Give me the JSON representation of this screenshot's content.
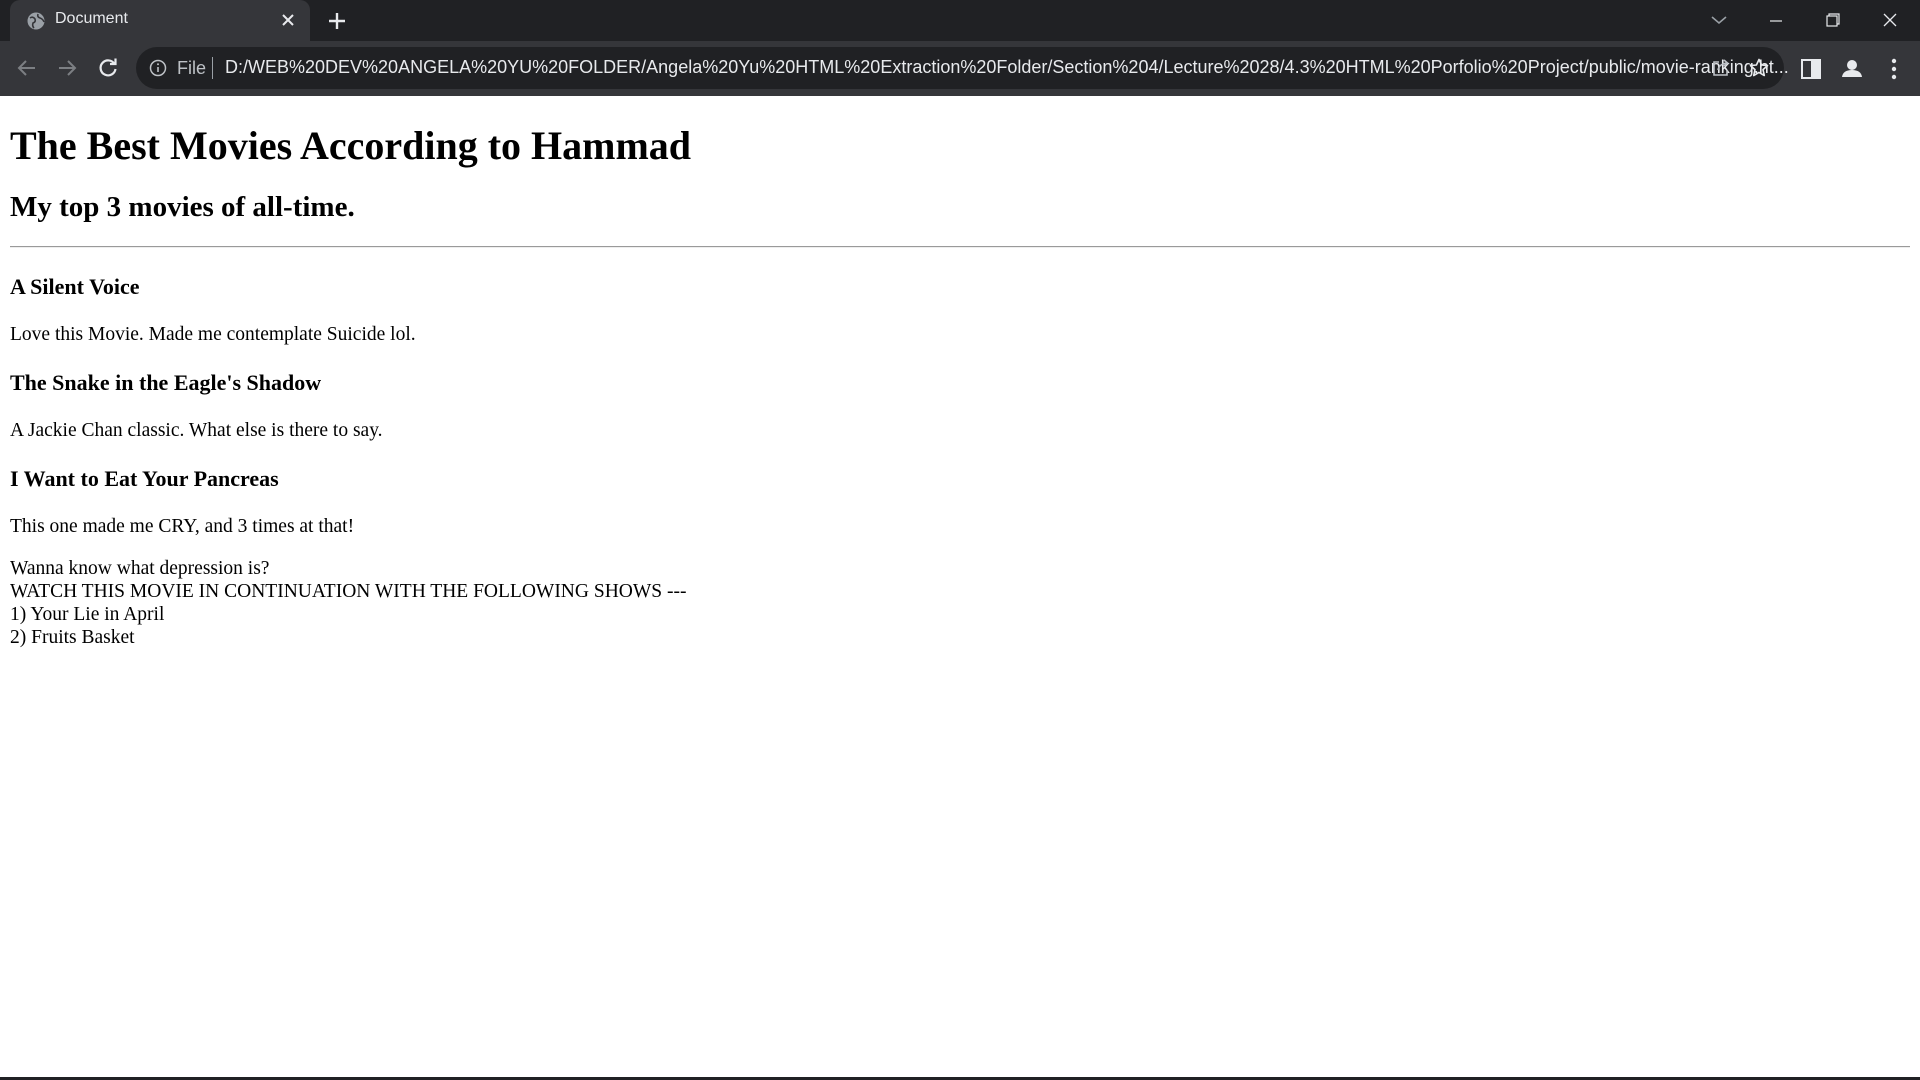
{
  "browser": {
    "tab_title": "Document",
    "scheme_label": "File",
    "url": "D:/WEB%20DEV%20ANGELA%20YU%20FOLDER/Angela%20Yu%20HTML%20Extraction%20Folder/Section%204/Lecture%2028/4.3%20HTML%20Porfolio%20Project/public/movie-ranking.ht..."
  },
  "page": {
    "title": "The Best Movies According to Hammad",
    "subtitle": "My top 3 movies of all-time.",
    "movies": [
      {
        "name": "A Silent Voice",
        "comment": "Love this Movie. Made me contemplate Suicide lol."
      },
      {
        "name": "The Snake in the Eagle's Shadow",
        "comment": "A Jackie Chan classic. What else is there to say."
      },
      {
        "name": "I Want to Eat Your Pancreas",
        "comment": "This one made me CRY, and 3 times at that!"
      }
    ],
    "notes": [
      "Wanna know what depression is?",
      "WATCH THIS MOVIE IN CONTINUATION WITH THE FOLLOWING SHOWS ---",
      "1) Your Lie in April",
      "2) Fruits Basket"
    ]
  },
  "icons": {
    "favicon": "globe-icon",
    "tab_close": "close-icon",
    "new_tab": "plus-icon",
    "tab_search": "chevron-down-icon",
    "minimize": "minimize-icon",
    "restore": "restore-icon",
    "window_close": "close-icon",
    "back": "arrow-left-icon",
    "forward": "arrow-right-icon",
    "reload": "reload-icon",
    "info": "info-icon",
    "share": "share-icon",
    "bookmark": "star-icon",
    "side_panel": "side-panel-icon",
    "profile": "profile-icon",
    "menu": "kebab-menu-icon"
  },
  "colors": {
    "tabstrip_bg": "#202124",
    "toolbar_bg": "#35363a",
    "omnibox_bg": "#202124",
    "chrome_text": "#e8eaed",
    "page_bg": "#ffffff",
    "page_text": "#000000"
  }
}
